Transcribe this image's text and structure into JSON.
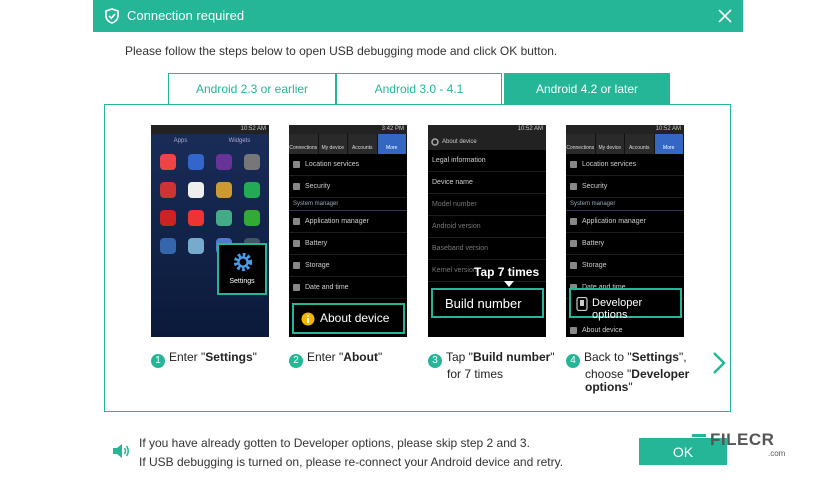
{
  "titlebar": {
    "title": "Connection required"
  },
  "instruction": "Please follow the steps below to open USB debugging mode and click OK button.",
  "tabs": [
    {
      "label": "Android 2.3 or earlier"
    },
    {
      "label": "Android 3.0 - 4.1"
    },
    {
      "label": "Android 4.2 or later"
    }
  ],
  "phones": {
    "status_time": "10:52 AM",
    "status_time_2": "3:42 PM",
    "p1": {
      "tabs": [
        "Apps",
        "Widgets"
      ],
      "callout": "Settings"
    },
    "p2": {
      "tabs": [
        "Connections",
        "My device",
        "Accounts",
        "More"
      ],
      "rows": [
        "Location services",
        "Security"
      ],
      "section": "System manager",
      "rows2": [
        "Application manager",
        "Battery",
        "Storage",
        "Date and time"
      ],
      "callout": "About device"
    },
    "p3": {
      "header": "About device",
      "rows": [
        "Legal information",
        "Device name",
        "Model number",
        "Android version",
        "Baseband version",
        "Kernel version"
      ],
      "tap_label": "Tap 7 times",
      "callout": "Build number"
    },
    "p4": {
      "tabs": [
        "Connections",
        "My device",
        "Accounts",
        "More"
      ],
      "rows": [
        "Location services",
        "Security"
      ],
      "section": "System manager",
      "rows2": [
        "Application manager",
        "Battery",
        "Storage",
        "Date and time"
      ],
      "callout": "Developer options",
      "last_row": "About device"
    }
  },
  "steps": [
    {
      "num": "1",
      "pre": "Enter \"",
      "bold": "Settings",
      "post": "\""
    },
    {
      "num": "2",
      "pre": "Enter \"",
      "bold": "About",
      "post": "\""
    },
    {
      "num": "3",
      "pre": "Tap \"",
      "bold": "Build number",
      "post": "\"",
      "line2": "for 7 times"
    },
    {
      "num": "4",
      "pre": "Back to \"",
      "bold": "Settings",
      "post": "\",",
      "line2_pre": "choose \"",
      "line2_bold": "Developer",
      "line3_bold": "options",
      "line3_post": "\""
    }
  ],
  "note": {
    "line1": "If you have already gotten to Developer options, please skip step 2 and 3.",
    "line2": "If USB debugging is turned on, please re-connect your Android device and retry."
  },
  "ok_label": "OK",
  "watermark": {
    "text": "FILECR",
    "sub": ".com"
  },
  "colors": {
    "accent": "#25b597"
  }
}
